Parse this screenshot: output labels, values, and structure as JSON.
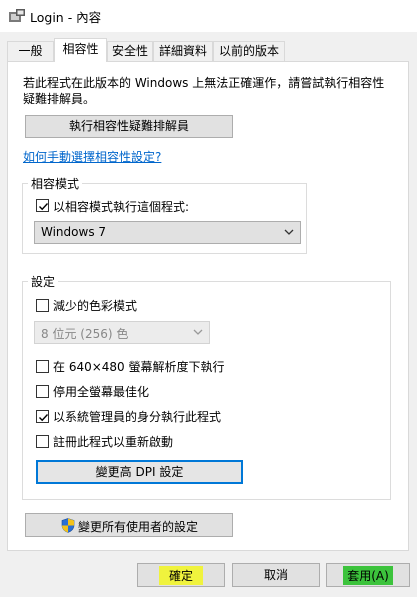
{
  "window": {
    "title": "Login - 內容"
  },
  "tabs": [
    {
      "label": "一般"
    },
    {
      "label": "相容性"
    },
    {
      "label": "安全性"
    },
    {
      "label": "詳細資料"
    },
    {
      "label": "以前的版本"
    }
  ],
  "intro": {
    "line1": "若此程式在此版本的 Windows 上無法正確運作，請嘗試執行相容性",
    "line2": "疑難排解員。"
  },
  "troubleshooter_button": "執行相容性疑難排解員",
  "manual_link": "如何手動選擇相容性設定?",
  "compat_mode": {
    "title": "相容模式",
    "checkbox_label": "以相容模式執行這個程式:",
    "checked": true,
    "selected_os": "Windows 7"
  },
  "settings": {
    "title": "設定",
    "reduced_color": {
      "label": "減少的色彩模式",
      "checked": false
    },
    "color_select": "8 位元 (256) 色",
    "res_640": {
      "label": "在 640×480 螢幕解析度下執行",
      "checked": false
    },
    "fullscreen_opt": {
      "label": "停用全螢幕最佳化",
      "checked": false
    },
    "run_admin": {
      "label": "以系統管理員的身分執行此程式",
      "checked": true
    },
    "register_restart": {
      "label": "註冊此程式以重新啟動",
      "checked": false
    },
    "dpi_button": "變更高 DPI 設定"
  },
  "all_users_button": "變更所有使用者的設定",
  "footer": {
    "ok": "確定",
    "cancel": "取消",
    "apply": "套用(A)"
  },
  "colors": {
    "highlight": "#f0f33d",
    "link": "#0066cc",
    "dpi_border": "#0078d7"
  }
}
